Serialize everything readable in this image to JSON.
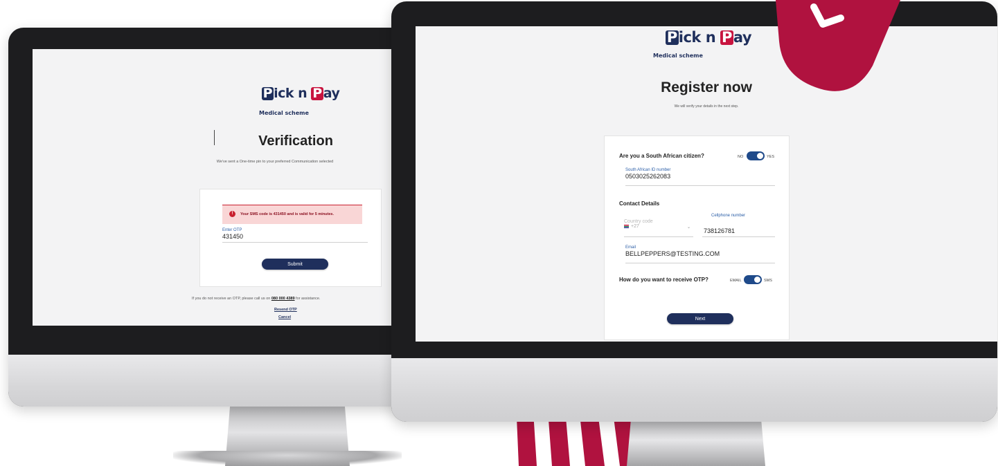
{
  "brand": {
    "logo_p1": "P",
    "logo_ick": "ick",
    "logo_n": "n",
    "logo_p2": "P",
    "logo_ay": "ay",
    "subtitle": "Medical scheme",
    "colors": {
      "navy": "#1f2f5c",
      "red": "#c8143f",
      "link_blue": "#2b5ea7"
    }
  },
  "verification": {
    "title": "Verification",
    "intro": "We've sent a One-time pin to your preferred Communication selected",
    "alert_icon": "!",
    "alert_text": "Your SMS code is 431450 and is valid for 5 minutes.",
    "otp_label": "Enter OTP",
    "otp_value": "431450",
    "submit_label": "Submit",
    "help_prefix": "If you do not receive an OTP, please call us on ",
    "help_phone": "080 000 4389",
    "help_suffix": " for assistance.",
    "resend_label": "Resend OTP",
    "cancel_label": "Cancel"
  },
  "register": {
    "title": "Register now",
    "intro": "We will verify your details in the next step.",
    "citizen_question": "Are you a South African citizen?",
    "citizen_no": "NO",
    "citizen_yes": "YES",
    "id_label": "South African ID number",
    "id_value": "0503025262083",
    "contact_heading": "Contact Details",
    "country_code_placeholder": "Country code",
    "country_code_value": "+27",
    "cellphone_label": "Cellphone number",
    "cellphone_value": "738126781",
    "email_label": "Email",
    "email_value": "BELLPEPPERS@TESTING.COM",
    "otp_question": "How do you want to receive OTP?",
    "otp_email": "EMAIL",
    "otp_sms": "SMS",
    "next_label": "Next"
  },
  "icons": [
    "error-icon",
    "south-africa-flag-icon",
    "chevron-down-icon",
    "clock-badge-icon"
  ]
}
